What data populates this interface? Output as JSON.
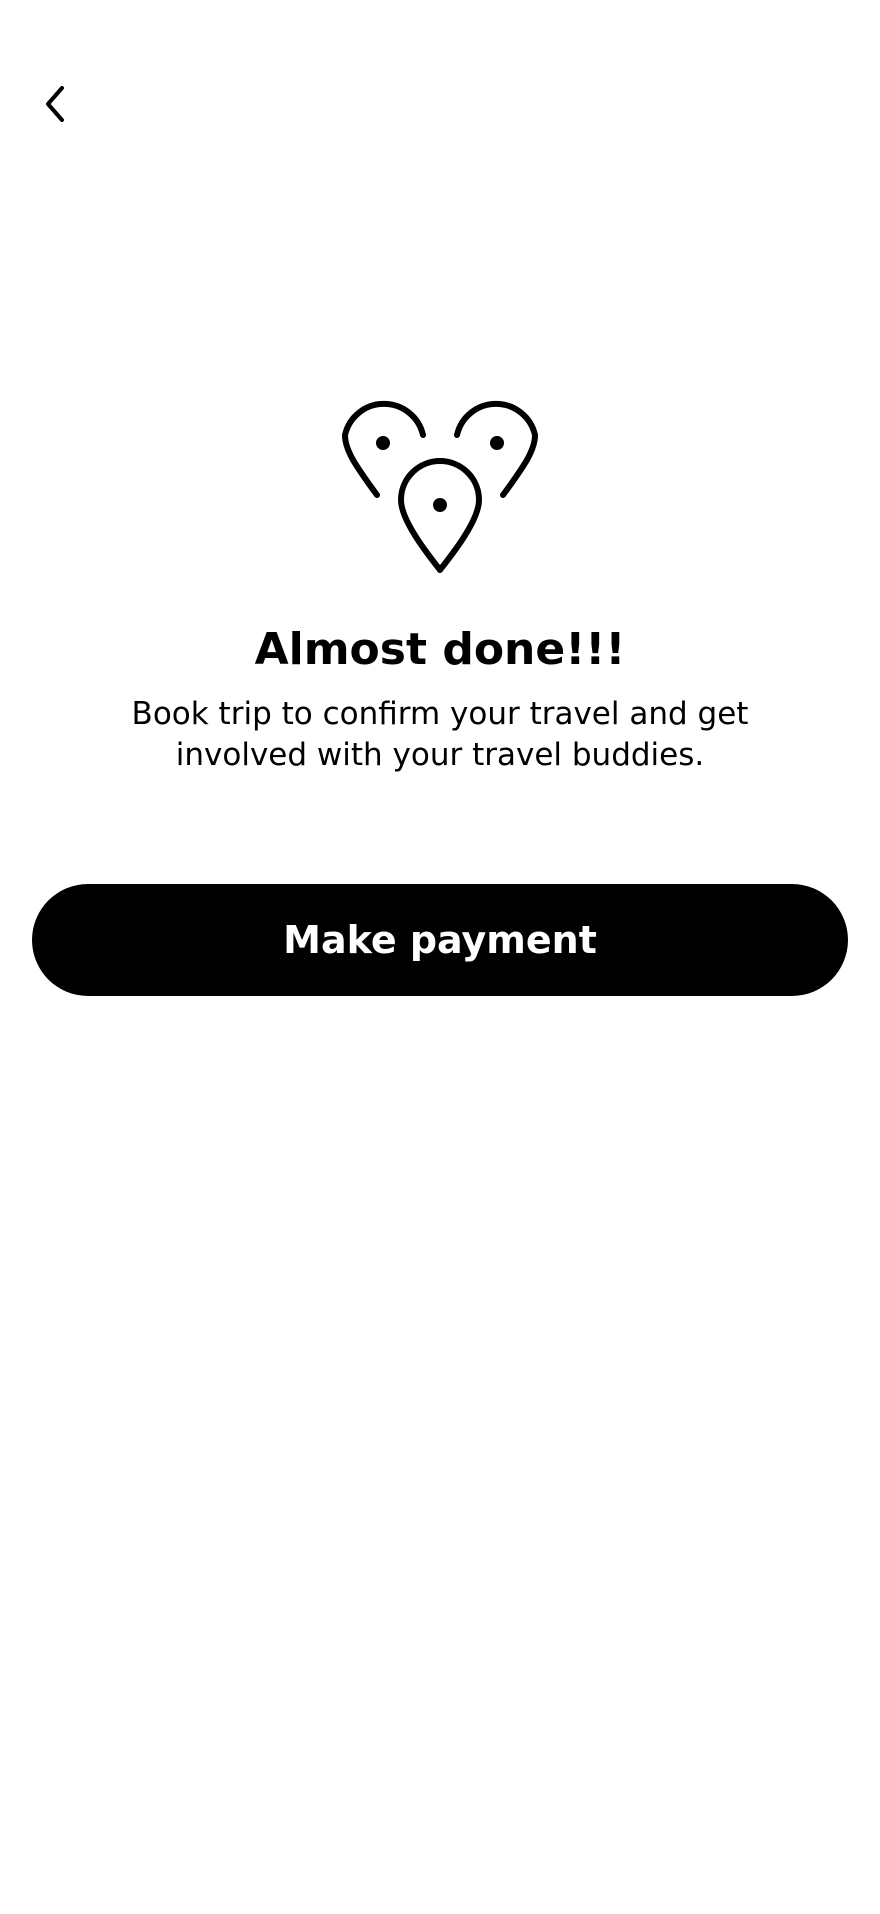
{
  "header": {
    "back_icon": "chevron-left-icon"
  },
  "hero": {
    "icon": "location-pins-icon",
    "title": "Almost done!!!",
    "subtitle": "Book trip to confirm your travel and get involved with your travel buddies."
  },
  "actions": {
    "primary_label": "Make payment"
  },
  "colors": {
    "background": "#ffffff",
    "text": "#000000",
    "button_bg": "#000000",
    "button_text": "#ffffff"
  }
}
